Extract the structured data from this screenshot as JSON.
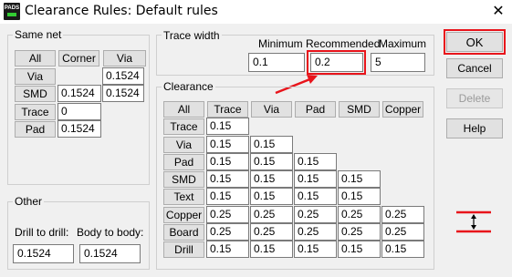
{
  "window": {
    "title": "Clearance Rules: Default rules",
    "close_label": "✕",
    "app_icon_text": "PADS"
  },
  "same_net": {
    "title": "Same net",
    "header_buttons": [
      "All",
      "Corner",
      "Via"
    ],
    "rows": [
      {
        "label": "Via",
        "values": [
          "",
          "",
          "0.1524"
        ]
      },
      {
        "label": "SMD",
        "values": [
          "",
          "0.1524",
          "0.1524"
        ]
      },
      {
        "label": "Trace",
        "values": [
          "",
          "0",
          ""
        ]
      },
      {
        "label": "Pad",
        "values": [
          "",
          "0.1524",
          ""
        ]
      }
    ]
  },
  "trace_width": {
    "title": "Trace width",
    "minimum_label": "Minimum",
    "recommended_label": "Recommended",
    "maximum_label": "Maximum",
    "minimum_value": "0.1",
    "recommended_value": "0.2",
    "maximum_value": "5"
  },
  "clearance": {
    "title": "Clearance",
    "all_label": "All",
    "columns": [
      "Trace",
      "Via",
      "Pad",
      "SMD",
      "Copper"
    ],
    "rows": [
      {
        "label": "Trace",
        "values": [
          "0.15"
        ]
      },
      {
        "label": "Via",
        "values": [
          "0.15",
          "0.15"
        ]
      },
      {
        "label": "Pad",
        "values": [
          "0.15",
          "0.15",
          "0.15"
        ]
      },
      {
        "label": "SMD",
        "values": [
          "0.15",
          "0.15",
          "0.15",
          "0.15"
        ]
      },
      {
        "label": "Text",
        "values": [
          "0.15",
          "0.15",
          "0.15",
          "0.15"
        ]
      },
      {
        "label": "Copper",
        "values": [
          "0.25",
          "0.25",
          "0.25",
          "0.25",
          "0.25"
        ]
      },
      {
        "label": "Board",
        "values": [
          "0.25",
          "0.25",
          "0.25",
          "0.25",
          "0.25"
        ]
      },
      {
        "label": "Drill",
        "values": [
          "0.15",
          "0.15",
          "0.15",
          "0.15",
          "0.15"
        ]
      }
    ]
  },
  "other": {
    "title": "Other",
    "drill_to_drill_label": "Drill to drill:",
    "body_to_body_label": "Body to body:",
    "drill_to_drill_value": "0.1524",
    "body_to_body_value": "0.1524"
  },
  "buttons": {
    "ok": "OK",
    "cancel": "Cancel",
    "delete": "Delete",
    "help": "Help"
  },
  "annotation_color": "#e8141b",
  "icons": {
    "clearance_indicator": "vertical-double-arrow-between-red-lines"
  }
}
